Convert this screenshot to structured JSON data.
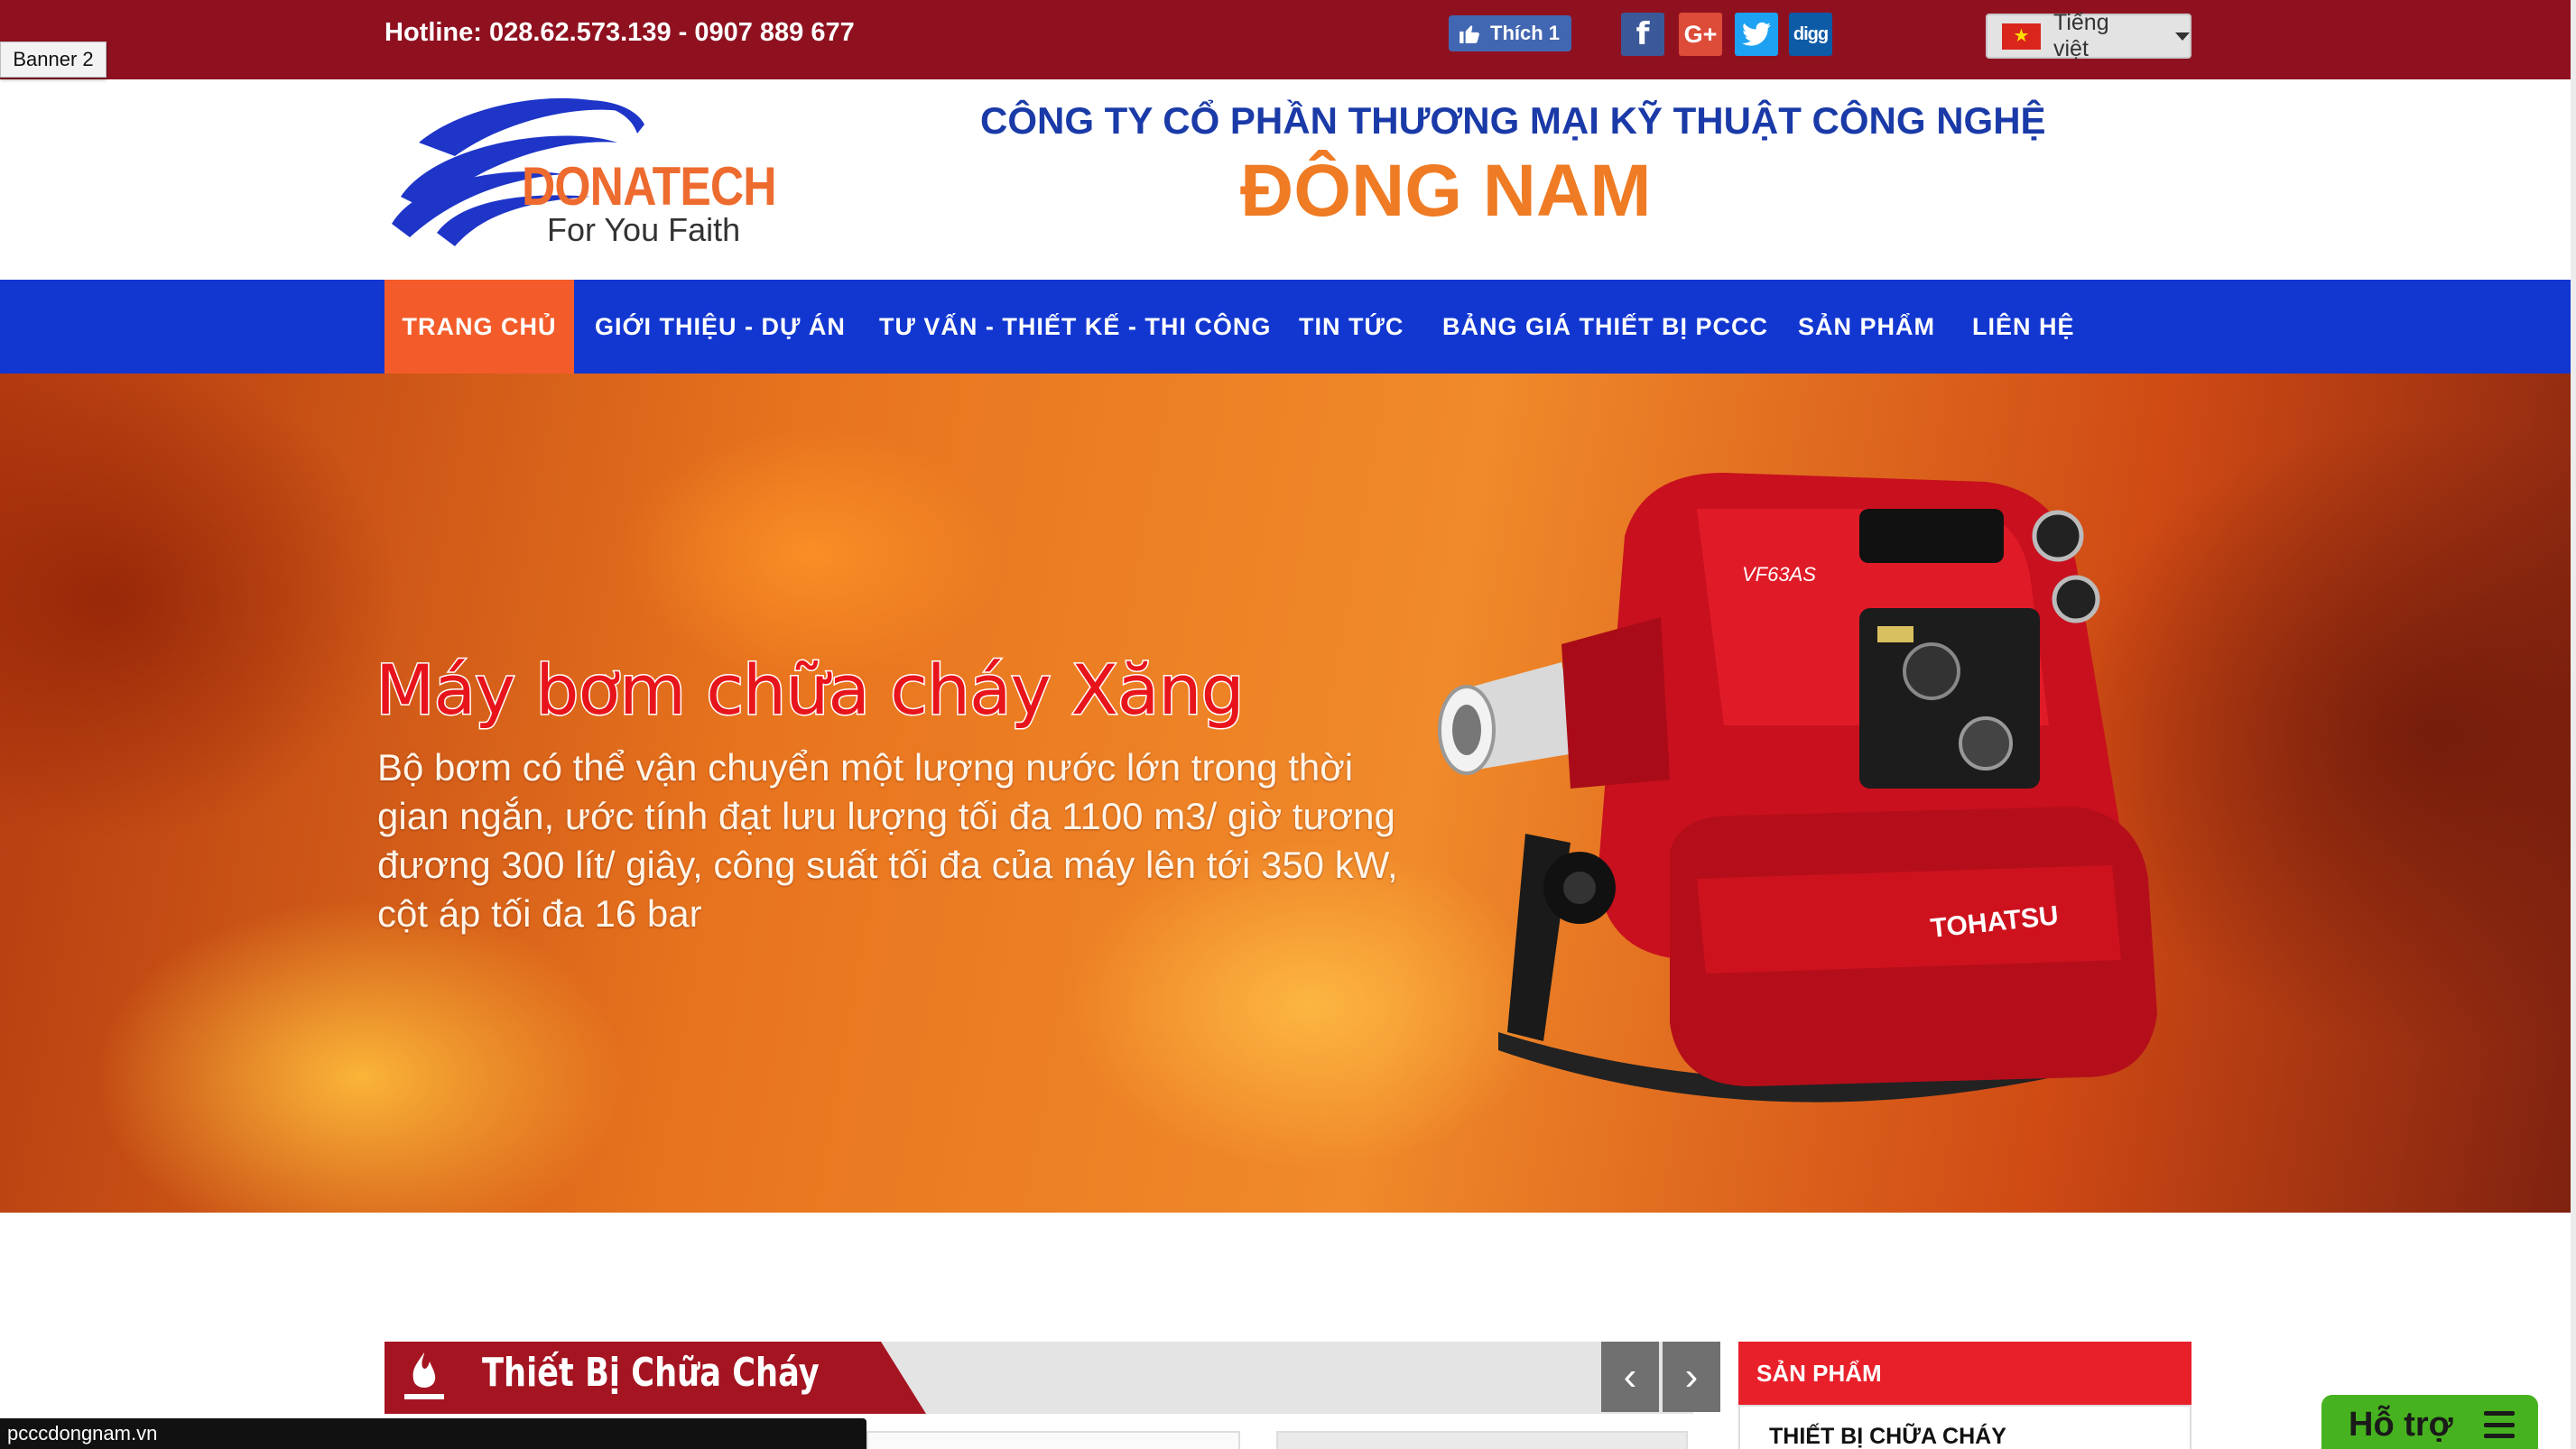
{
  "topbar": {
    "hotline": "Hotline: 028.62.573.139 -  0907 889 677",
    "like_label": "Thích 1",
    "social": {
      "facebook": "f",
      "googleplus": "G+",
      "digg": "digg"
    },
    "language": "Tiếng việt",
    "banner_tag": "Banner 2"
  },
  "header": {
    "logo_name": "DONATECH",
    "logo_tagline": "For You Faith",
    "company_line1": "CÔNG TY CỔ PHẦN THƯƠNG MẠI KỸ THUẬT CÔNG NGHỆ",
    "company_line2": "ĐÔNG NAM"
  },
  "nav": {
    "items": [
      {
        "label": "TRANG CHỦ"
      },
      {
        "label": "GIỚI THIỆU - DỰ ÁN"
      },
      {
        "label": "TƯ VẤN - THIẾT KẾ - THI CÔNG"
      },
      {
        "label": "TIN TỨC"
      },
      {
        "label": "BẢNG GIÁ THIẾT BỊ PCCC"
      },
      {
        "label": "SẢN PHẨM"
      },
      {
        "label": "LIÊN HỆ"
      }
    ]
  },
  "hero": {
    "title": "Máy bơm chữa cháy Xăng",
    "description": "Bộ bơm có thể vận chuyển một lượng nước lớn trong thời gian ngắn, ước tính đạt lưu lượng tối đa 1100 m3/ giờ tương đương 300 lít/ giây, công suất tối đa của máy lên tới 350 kW, cột áp tối đa 16 bar",
    "pump_brand": "TOHATSU",
    "pump_model": "VF63AS"
  },
  "section": {
    "title": "Thiết Bị Chữa Cháy",
    "prev": "‹",
    "next": "›"
  },
  "sidebar": {
    "heading": "SẢN PHẨM",
    "first_item": "THIẾT BỊ CHỮA CHÁY"
  },
  "status_url": "pcccdongnam.vn",
  "support": {
    "label": "Hỗ trợ"
  },
  "colors": {
    "topbar": "#8f1120",
    "nav": "#1237d1",
    "nav_active": "#f35c2a",
    "company_blue": "#1a3aa8",
    "company_orange": "#ef7b24",
    "section_red": "#a51421",
    "sidebar_red": "#e8202a",
    "support_green": "#47b21f"
  },
  "icons": [
    "thumbs-up-icon",
    "facebook-icon",
    "google-plus-icon",
    "twitter-icon",
    "digg-icon",
    "vietnam-flag-icon",
    "caret-down-icon",
    "fire-extinguisher-icon",
    "chevron-left-icon",
    "chevron-right-icon",
    "menu-icon"
  ]
}
